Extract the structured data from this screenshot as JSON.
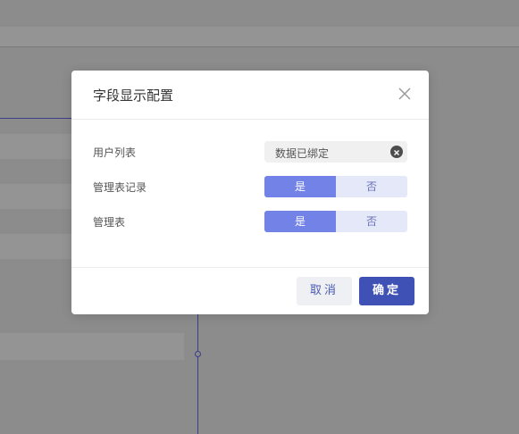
{
  "dialog": {
    "title": "字段显示配置",
    "rows": [
      {
        "label": "用户列表",
        "tag_value": "数据已绑定"
      },
      {
        "label": "管理表记录",
        "yes_label": "是",
        "no_label": "否",
        "selected": "是"
      },
      {
        "label": "管理表",
        "yes_label": "是",
        "no_label": "否",
        "selected": "是"
      }
    ],
    "cancel_label": "取消",
    "confirm_label": "确定"
  },
  "colors": {
    "overlay": "#8c8c8c",
    "accent": "#3f51b5",
    "toggle_on": "#7282e6",
    "toggle_off": "#e4e8f9"
  },
  "icons": {
    "close": "close-icon",
    "clear": "clear-circle-icon"
  }
}
